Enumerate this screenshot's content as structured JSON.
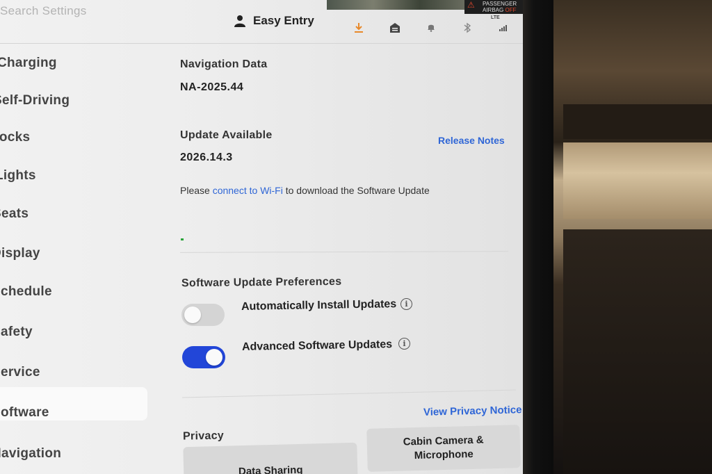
{
  "topbar": {
    "search_text": "Search Settings",
    "profile_label": "Easy Entry",
    "airbag_line1": "PASSENGER",
    "airbag_line2": "AIRBAG",
    "airbag_status": "OFF",
    "network_label": "LTE",
    "accent_download": "#e8892a"
  },
  "sidebar": {
    "items": [
      {
        "label": "Charging"
      },
      {
        "label": "Self-Driving"
      },
      {
        "label": "Locks"
      },
      {
        "label": "Lights"
      },
      {
        "label": "Seats"
      },
      {
        "label": "Display"
      },
      {
        "label": "Schedule"
      },
      {
        "label": "Safety"
      },
      {
        "label": "Service"
      },
      {
        "label": "Software"
      },
      {
        "label": "Navigation"
      }
    ],
    "active": "Software"
  },
  "main": {
    "nav_data_label": "Navigation Data",
    "nav_data_value": "NA-2025.44",
    "update_label": "Update Available",
    "update_version": "2026.14.3",
    "release_notes_link": "Release Notes",
    "wifi_msg_before": "Please ",
    "wifi_msg_link": "connect to Wi-Fi",
    "wifi_msg_after": " to download the Software Update",
    "prefs_title": "Software Update Preferences",
    "auto_install_label": "Automatically Install Updates",
    "auto_install_on": false,
    "advanced_label": "Advanced Software Updates",
    "advanced_on": true,
    "info_glyph": "i",
    "privacy_title": "Privacy",
    "privacy_notice_link": "View Privacy Notice",
    "data_sharing_button": "Data Sharing",
    "cabin_camera_button": "Cabin Camera & Microphone"
  },
  "colors": {
    "link": "#2f66d6",
    "toggle_on": "#2246d8",
    "toggle_off": "#d4d4d4"
  }
}
